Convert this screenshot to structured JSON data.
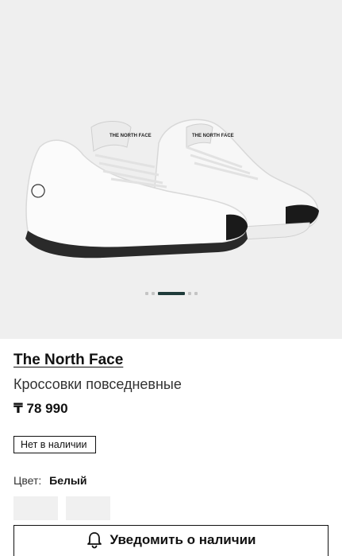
{
  "gallery": {
    "image_name": "sneaker-pair-image",
    "slides_total": 5,
    "active_slide": 3,
    "logo_text": "THE NORTH FACE"
  },
  "product": {
    "brand": "The North Face",
    "name": "Кроссовки повседневные",
    "price": "₸ 78 990",
    "stock_status": "Нет в наличии"
  },
  "color": {
    "label": "Цвет:",
    "value": "Белый"
  },
  "notify_button": {
    "label": "Уведомить о наличии",
    "icon": "bell-icon"
  }
}
